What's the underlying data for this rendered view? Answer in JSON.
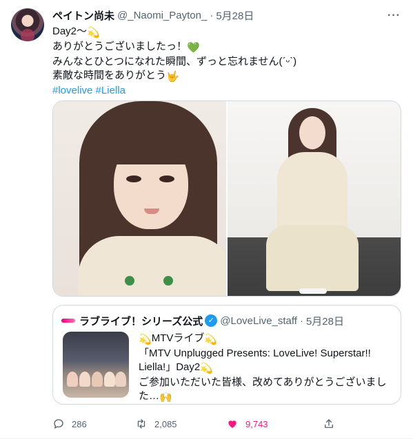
{
  "tweet": {
    "display_name": "ペイトン尚未",
    "handle": "@_Naomi_Payton_",
    "separator": "·",
    "timestamp": "5月28日",
    "more_label": "···",
    "lines": [
      "Day2〜",
      "ありがとうございましたっ！",
      "みんなとひとつになれた瞬間、ずっと忘れません(ˊᵕˋ)",
      "素敵な時間をありがとう"
    ],
    "emojis": {
      "line1": "💫",
      "line2": "💚",
      "line4": "🤟"
    },
    "hashtags": [
      "#lovelive",
      "#Liella"
    ],
    "media": [
      {
        "icon": "selfie-photo"
      },
      {
        "icon": "full-body-photo"
      }
    ]
  },
  "quote": {
    "display_name": "ラブライブ！シリーズ公式",
    "verified_mark": "✓",
    "handle": "@LoveLive_staff",
    "separator": "·",
    "timestamp": "5月28日",
    "lines": [
      "MTVライブ",
      "「MTV Unplugged Presents: LoveLive! Superstar!!",
      "Liella!」Day2",
      "ご参加いただいた皆様、改めてありがとうございまし",
      "た…"
    ],
    "emojis": {
      "sparkle": "💫",
      "hands": "🙌"
    }
  },
  "actions": {
    "reply_count": "286",
    "retweet_count": "2,085",
    "like_count": "9,743",
    "like_color": "#f91880"
  },
  "colors": {
    "link": "#1d9bf0",
    "secondary_text": "#536471",
    "border": "#cfd9de"
  }
}
